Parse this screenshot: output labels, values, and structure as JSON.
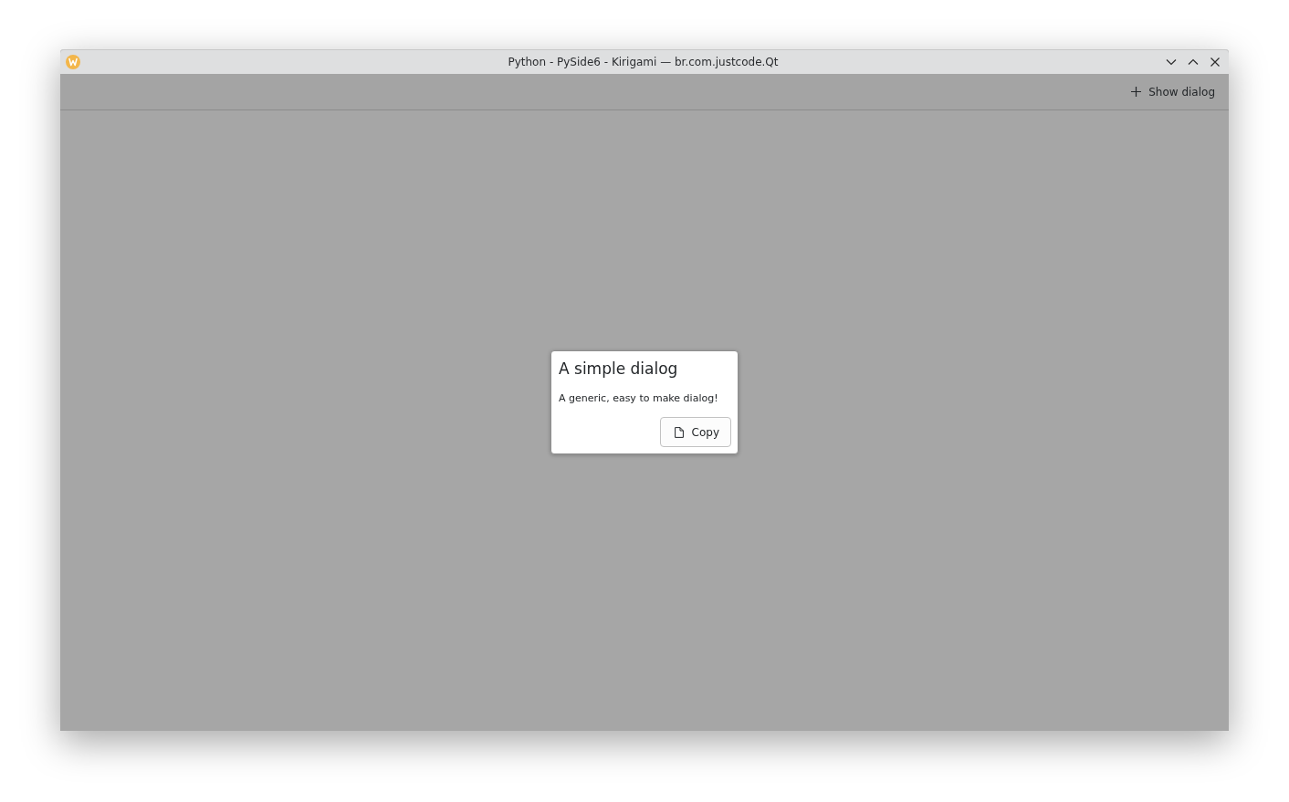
{
  "window": {
    "title": "Python - PySide6 - Kirigami — br.com.justcode.Qt"
  },
  "toolbar": {
    "actions": [
      {
        "label": "Show dialog"
      }
    ]
  },
  "dialog": {
    "title": "A simple dialog",
    "message": "A generic, easy to make dialog!",
    "buttons": [
      {
        "label": "Copy"
      }
    ]
  }
}
